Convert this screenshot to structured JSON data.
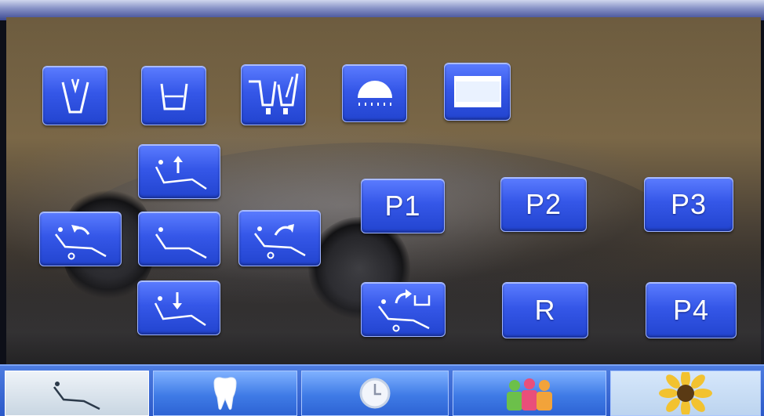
{
  "presets": {
    "p1": "P1",
    "p2": "P2",
    "p3": "P3",
    "p4": "P4",
    "r": "R"
  },
  "icons": {
    "cup_fill": "cup-fill-icon",
    "bowl_flush": "bowl-flush-icon",
    "cup_bowl_combined": "cup-and-bowl-icon",
    "operating_light": "operating-light-icon",
    "film_viewer": "film-viewer-icon",
    "backrest_up": "backrest-up-icon",
    "backrest_tilt_back": "backrest-tilt-back-icon",
    "chair_neutral": "chair-neutral-icon",
    "backrest_tilt_forward": "backrest-tilt-forward-icon",
    "backrest_down": "backrest-down-icon",
    "return_position": "return-to-position-icon"
  },
  "bottom_tabs": [
    {
      "id": "chair",
      "icon": "chair-icon",
      "active": true
    },
    {
      "id": "tooth",
      "icon": "tooth-icon",
      "active": false
    },
    {
      "id": "clock",
      "icon": "clock-icon",
      "active": false
    },
    {
      "id": "users",
      "icon": "users-icon",
      "active": false
    },
    {
      "id": "sunflower",
      "icon": "sunflower-icon",
      "active": false
    }
  ],
  "colors": {
    "button_blue": "#3557e8",
    "button_border": "#9fb4ff",
    "bar_blue": "#2a58c8",
    "active_tab": "#dce5ee"
  }
}
